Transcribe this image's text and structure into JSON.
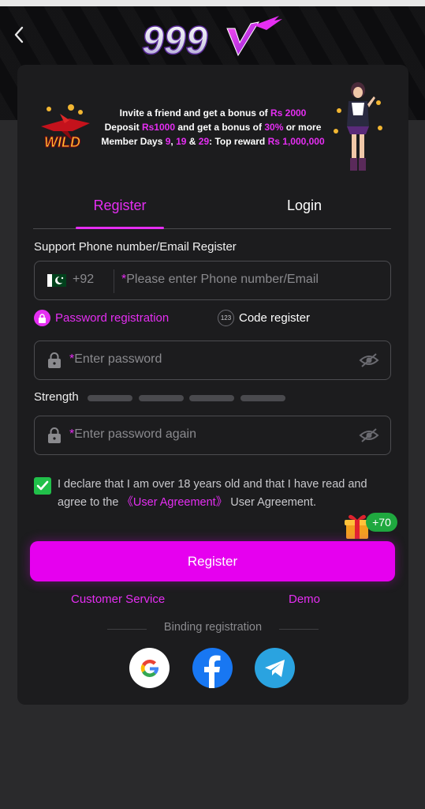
{
  "header": {
    "logo_text": "999",
    "back_icon": "chevron-left-icon"
  },
  "banner": {
    "line1_a": "Invite a friend and get a bonus of ",
    "line1_b": "Rs 2000",
    "line2_a": "Deposit ",
    "line2_b": "Rs1000",
    "line2_c": " and get a bonus of ",
    "line2_d": "30%",
    "line2_e": " or more",
    "line3_a": "Member Days ",
    "line3_b": "9",
    "line3_c": ", ",
    "line3_d": "19",
    "line3_e": " & ",
    "line3_f": "29",
    "line3_g": ": Top reward ",
    "line3_h": "Rs 1,000,000",
    "wild_text": "WILD"
  },
  "tabs": {
    "register": "Register",
    "login": "Login"
  },
  "form": {
    "section_label": "Support Phone number/Email Register",
    "country_code": "+92",
    "phone_placeholder": "Please enter Phone number/Email",
    "mode_password": "Password registration",
    "mode_code": "Code register",
    "code_icon_text": "123",
    "password_placeholder": "Enter password",
    "password_again_placeholder": "Enter password again",
    "strength_label": "Strength",
    "required_mark": "*"
  },
  "agreement": {
    "text_a": "I declare that I am over 18 years old and that I have read and agree to the ",
    "link": "《User Agreement》",
    "text_b": " User Agreement."
  },
  "bonus_badge": "+70",
  "register_button": "Register",
  "links": {
    "customer_service": "Customer Service",
    "demo": "Demo"
  },
  "binding_label": "Binding registration",
  "colors": {
    "accent": "#e52ef2",
    "button": "#e600ef",
    "check": "#21c04a",
    "background": "#2a2a2c",
    "card": "#1c1c1e"
  }
}
